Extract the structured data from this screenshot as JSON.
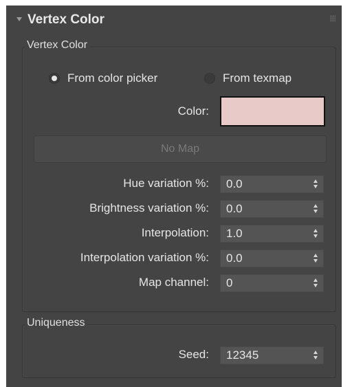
{
  "rollout": {
    "title": "Vertex Color"
  },
  "vertex_color_group": {
    "label": "Vertex Color",
    "source_options": [
      {
        "label": "From color picker",
        "checked": true
      },
      {
        "label": "From texmap",
        "checked": false
      }
    ],
    "color_label": "Color:",
    "color_value": "#e8cbc8",
    "map_button_label": "No Map",
    "fields": [
      {
        "label": "Hue variation %:",
        "value": "0.0"
      },
      {
        "label": "Brightness variation %:",
        "value": "0.0"
      },
      {
        "label": "Interpolation:",
        "value": "1.0"
      },
      {
        "label": "Interpolation variation %:",
        "value": "0.0"
      },
      {
        "label": "Map channel:",
        "value": "0"
      }
    ]
  },
  "uniqueness_group": {
    "label": "Uniqueness",
    "seed_label": "Seed:",
    "seed_value": "12345"
  }
}
